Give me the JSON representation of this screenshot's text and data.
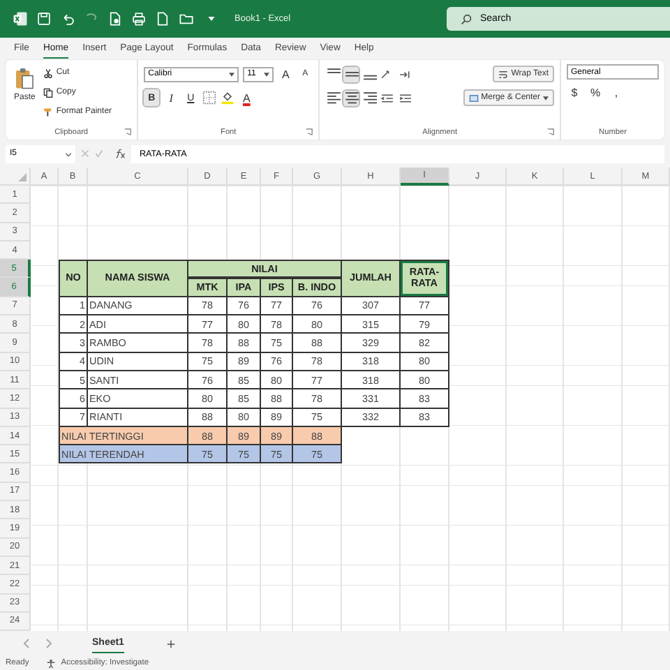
{
  "title_bar": {
    "title": "Book1 - Excel",
    "search_placeholder": "Search"
  },
  "menu_tabs": [
    {
      "label": "File",
      "selected": false
    },
    {
      "label": "Home",
      "selected": true
    },
    {
      "label": "Insert",
      "selected": false
    },
    {
      "label": "Page Layout",
      "selected": false
    },
    {
      "label": "Formulas",
      "selected": false
    },
    {
      "label": "Data",
      "selected": false
    },
    {
      "label": "Review",
      "selected": false
    },
    {
      "label": "View",
      "selected": false
    },
    {
      "label": "Help",
      "selected": false
    }
  ],
  "ribbon": {
    "clipboard": {
      "paste": "Paste",
      "cut": "Cut",
      "copy": "Copy",
      "format_painter": "Format Painter",
      "label": "Clipboard"
    },
    "font": {
      "name": "Calibri",
      "size": "11",
      "grow": "A",
      "shrink": "A",
      "bold": {
        "text": "B",
        "on": true
      },
      "italic": {
        "text": "I",
        "on": false
      },
      "underline": {
        "text": "U",
        "on": false
      },
      "font_color": "A",
      "label": "Font"
    },
    "alignment": {
      "vertical": [
        {
          "kind": "top",
          "selected": false
        },
        {
          "kind": "middle",
          "selected": true
        },
        {
          "kind": "bottom",
          "selected": false
        }
      ],
      "horizontal": [
        {
          "kind": "left",
          "selected": false
        },
        {
          "kind": "center",
          "selected": true
        },
        {
          "kind": "right",
          "selected": false
        }
      ],
      "wrap_text": "Wrap Text",
      "merge_center": "Merge & Center",
      "label": "Alignment"
    },
    "number": {
      "format": "General",
      "symbols": [
        "$",
        "%",
        ","
      ],
      "label": "Number"
    }
  },
  "formula_bar": {
    "name_box": "I5",
    "formula": "RATA-RATA"
  },
  "sheet": {
    "columns": [
      {
        "label": "A",
        "selected": false
      },
      {
        "label": "B",
        "selected": false
      },
      {
        "label": "C",
        "selected": false
      },
      {
        "label": "D",
        "selected": false
      },
      {
        "label": "E",
        "selected": false
      },
      {
        "label": "F",
        "selected": false
      },
      {
        "label": "G",
        "selected": false
      },
      {
        "label": "H",
        "selected": false
      },
      {
        "label": "I",
        "selected": true
      },
      {
        "label": "J",
        "selected": false
      },
      {
        "label": "K",
        "selected": false
      },
      {
        "label": "L",
        "selected": false
      },
      {
        "label": "M",
        "selected": false
      }
    ],
    "rows": [
      {
        "label": "1",
        "selected": false
      },
      {
        "label": "2",
        "selected": false
      },
      {
        "label": "3",
        "selected": false
      },
      {
        "label": "4",
        "selected": false
      },
      {
        "label": "5",
        "selected": true
      },
      {
        "label": "6",
        "selected": true
      },
      {
        "label": "7",
        "selected": false
      },
      {
        "label": "8",
        "selected": false
      },
      {
        "label": "9",
        "selected": false
      },
      {
        "label": "10",
        "selected": false
      },
      {
        "label": "11",
        "selected": false
      },
      {
        "label": "12",
        "selected": false
      },
      {
        "label": "13",
        "selected": false
      },
      {
        "label": "14",
        "selected": false
      },
      {
        "label": "15",
        "selected": false
      },
      {
        "label": "16",
        "selected": false
      },
      {
        "label": "17",
        "selected": false
      },
      {
        "label": "18",
        "selected": false
      },
      {
        "label": "19",
        "selected": false
      },
      {
        "label": "20",
        "selected": false
      },
      {
        "label": "21",
        "selected": false
      },
      {
        "label": "22",
        "selected": false
      },
      {
        "label": "23",
        "selected": false
      },
      {
        "label": "24",
        "selected": false
      }
    ],
    "table": {
      "head": [
        {
          "text": "NO",
          "selected": false
        },
        {
          "text": "NAMA SISWA",
          "selected": false
        },
        {
          "text": "NILAI",
          "selected": false
        },
        {
          "text": "MTK",
          "selected": false
        },
        {
          "text": "IPA",
          "selected": false
        },
        {
          "text": "IPS",
          "selected": false
        },
        {
          "text": "B. INDO",
          "selected": false
        },
        {
          "text": "JUMLAH",
          "selected": false
        },
        {
          "text": "RATA-RATA",
          "selected": true
        }
      ],
      "rows": [
        {
          "no": "1",
          "name": "DANANG",
          "scores": [
            "78",
            "76",
            "77",
            "76"
          ],
          "total": "307",
          "average": "77"
        },
        {
          "no": "2",
          "name": "ADI",
          "scores": [
            "77",
            "80",
            "78",
            "80"
          ],
          "total": "315",
          "average": "79"
        },
        {
          "no": "3",
          "name": "RAMBO",
          "scores": [
            "78",
            "88",
            "75",
            "88"
          ],
          "total": "329",
          "average": "82"
        },
        {
          "no": "4",
          "name": "UDIN",
          "scores": [
            "75",
            "89",
            "76",
            "78"
          ],
          "total": "318",
          "average": "80"
        },
        {
          "no": "5",
          "name": "SANTI",
          "scores": [
            "76",
            "85",
            "80",
            "77"
          ],
          "total": "318",
          "average": "80"
        },
        {
          "no": "6",
          "name": "EKO",
          "scores": [
            "80",
            "85",
            "88",
            "78"
          ],
          "total": "331",
          "average": "83"
        },
        {
          "no": "7",
          "name": "RIANTI",
          "scores": [
            "88",
            "80",
            "89",
            "75"
          ],
          "total": "332",
          "average": "83"
        }
      ],
      "summary": [
        {
          "kind": "max",
          "label": "NILAI TERTINGGI",
          "scores": [
            "88",
            "89",
            "89",
            "88"
          ]
        },
        {
          "kind": "min",
          "label": "NILAI TERENDAH",
          "scores": [
            "75",
            "75",
            "75",
            "75"
          ]
        }
      ]
    }
  },
  "sheet_tabs": [
    {
      "label": "Sheet1",
      "selected": true
    }
  ],
  "status_bar": {
    "mode": "Ready",
    "accessibility": "Accessibility: Investigate"
  }
}
